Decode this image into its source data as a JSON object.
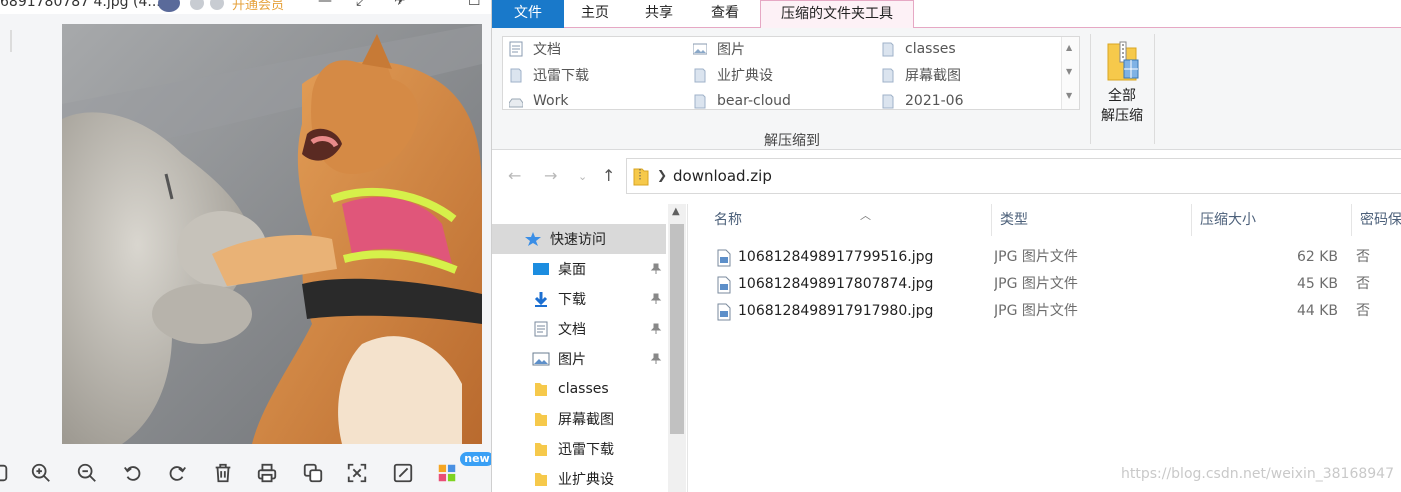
{
  "viewer": {
    "title": "6891780787 4.jpg (4...",
    "vip_label": "开通会员",
    "new_badge": "new",
    "tools": [
      {
        "icon": "frame-icon"
      },
      {
        "icon": "zoom-in-icon"
      },
      {
        "icon": "zoom-out-icon"
      },
      {
        "icon": "rotate-left-icon"
      },
      {
        "icon": "rotate-right-icon"
      },
      {
        "icon": "delete-icon"
      },
      {
        "icon": "print-icon"
      },
      {
        "icon": "convert-icon"
      },
      {
        "icon": "ocr-icon"
      },
      {
        "icon": "edit-icon"
      },
      {
        "icon": "apps-icon"
      }
    ]
  },
  "explorer": {
    "tabs": {
      "file": "文件",
      "home": "主页",
      "share": "共享",
      "view": "查看",
      "compressed_tools": "压缩的文件夹工具"
    },
    "ribbon": {
      "destinations": [
        [
          "文档",
          "图片",
          "classes"
        ],
        [
          "迅雷下载",
          "业扩典设",
          "屏幕截图"
        ],
        [
          "Work",
          "bear-cloud",
          "2021-06"
        ]
      ],
      "group_label": "解压缩到",
      "extract_all_line1": "全部",
      "extract_all_line2": "解压缩"
    },
    "address": {
      "path": "download.zip"
    },
    "nav": {
      "quick_access": "快速访问",
      "items": [
        "桌面",
        "下载",
        "文档",
        "图片",
        "classes",
        "屏幕截图",
        "迅雷下载",
        "业扩典设"
      ]
    },
    "columns": {
      "name": "名称",
      "type": "类型",
      "compressed_size": "压缩大小",
      "password": "密码保"
    },
    "files": [
      {
        "name": "1068128498917799516.jpg",
        "type": "JPG 图片文件",
        "size": "62 KB",
        "password": "否"
      },
      {
        "name": "1068128498917807874.jpg",
        "type": "JPG 图片文件",
        "size": "45 KB",
        "password": "否"
      },
      {
        "name": "1068128498917917980.jpg",
        "type": "JPG 图片文件",
        "size": "44 KB",
        "password": "否"
      }
    ],
    "watermark": "https://blog.csdn.net/weixin_38168947"
  },
  "colors": {
    "file_tab": "#1979ca",
    "context_tab_border": "#e6a8c4",
    "column_header_text": "#4c607a",
    "selected_nav": "#d9d9d9"
  }
}
